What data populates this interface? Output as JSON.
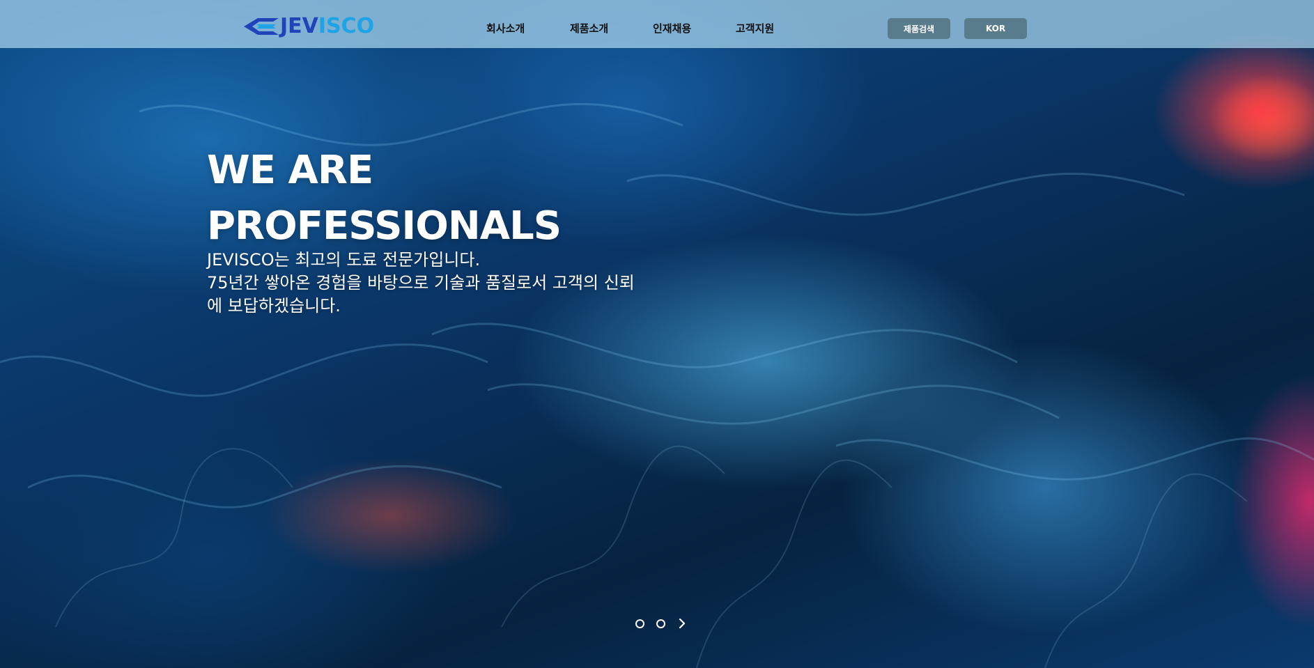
{
  "header": {
    "logo": {
      "text_dark": "JEV",
      "text_light": "ISCO",
      "icon": "jevisco-logo-mark-icon",
      "colors": {
        "dark": "#1f43b8",
        "light": "#1ea3e6"
      }
    },
    "nav": [
      {
        "label": "회사소개"
      },
      {
        "label": "제품소개"
      },
      {
        "label": "인재채용"
      },
      {
        "label": "고객지원"
      }
    ],
    "product_search_label": "제품검색",
    "language_label": "KOR"
  },
  "hero": {
    "headline_line1": "WE ARE",
    "headline_line2": "PROFESSIONALS",
    "body_line1": "JEVISCO는 최고의 도료 전문가입니다.",
    "body_line2": "75년간 쌓아온 경험을 바탕으로 기술과 품질로서 고객의 신뢰",
    "body_line3": "에 보답하겠습니다.",
    "slider": {
      "slide_count": 2,
      "next_icon": "chevron-right-icon"
    }
  },
  "colors": {
    "header_bg": "#aad7f0",
    "pill_bg": "#587c8c",
    "hero_deep": "#06223f",
    "hero_bright": "#5ac8ff",
    "accent_red": "#ff3c46"
  }
}
